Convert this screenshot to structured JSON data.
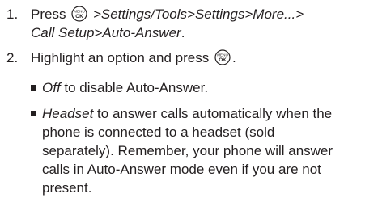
{
  "steps": [
    {
      "number": "1.",
      "pre": "Press",
      "menu_key_label_top": "MENU",
      "menu_key_label_bottom": "OK",
      "line1_italic": ">Settings/Tools>Settings>More...>",
      "line2_italic": "Call Setup>Auto-Answer",
      "line2_end": "."
    },
    {
      "number": "2.",
      "pre": "Highlight an option and press",
      "menu_key_label_top": "MENU",
      "menu_key_label_bottom": "OK",
      "end": "."
    }
  ],
  "bullets": [
    {
      "term": "Off",
      "text": " to disable Auto-Answer."
    },
    {
      "term": "Headset",
      "lines": [
        " to answer calls automatically when the",
        "phone is connected to a headset (sold",
        "separately). Remember, your phone will answer",
        "calls in Auto-Answer mode even if you are not",
        "present."
      ]
    }
  ],
  "colors": {
    "text": "#231f20"
  }
}
